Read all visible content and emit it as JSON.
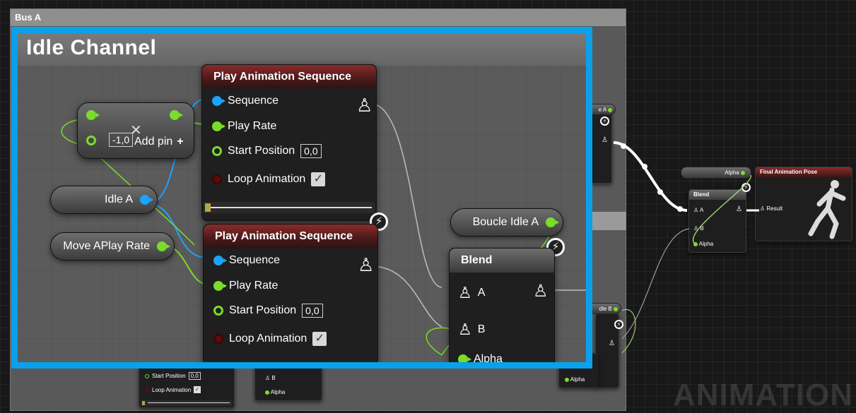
{
  "bus_comment": {
    "title": "Bus A"
  },
  "zoom": {
    "title": "Idle Channel",
    "nodes": {
      "play1": {
        "title": "Play Animation Sequence",
        "sequence": "Sequence",
        "play_rate": "Play Rate",
        "start_position": "Start Position",
        "start_value": "0,0",
        "loop": "Loop Animation"
      },
      "play2": {
        "title": "Play Animation Sequence",
        "sequence": "Sequence",
        "play_rate": "Play Rate",
        "start_position": "Start Position",
        "start_value": "0,0",
        "loop": "Loop Animation"
      },
      "multiply": {
        "value": "-1,0",
        "add_pin": "Add pin"
      },
      "idle_a": "Idle A",
      "move_rate": "Move APlay Rate",
      "boucle": "Boucle Idle A",
      "blend": {
        "title": "Blend",
        "pin_a": "A",
        "pin_b": "B",
        "alpha": "Alpha"
      }
    }
  },
  "right_side": {
    "alpha_pill": "Alpha",
    "blend": {
      "title": "Blend",
      "pin_a": "A",
      "pin_b": "B",
      "alpha": "Alpha"
    },
    "final": {
      "title": "Final Animation Pose",
      "result": "Result"
    },
    "cut_top": "e A",
    "cut_bottom": "dle B",
    "lower_alpha": "Alpha"
  },
  "bottom_left": {
    "start_position": "Start Position",
    "start_value": "0,0",
    "loop": "Loop Animation",
    "pin_b": "B",
    "alpha": "Alpha"
  },
  "watermark": "ANIMATION",
  "colors": {
    "accent_frame": "#0aa0ea",
    "exec_pin": "#ffffff",
    "pose_wire": "#ffffff",
    "float_pin": "#7cdc2c",
    "object_pin": "#1aa3ff",
    "bool_pin": "#5a0c0c"
  }
}
